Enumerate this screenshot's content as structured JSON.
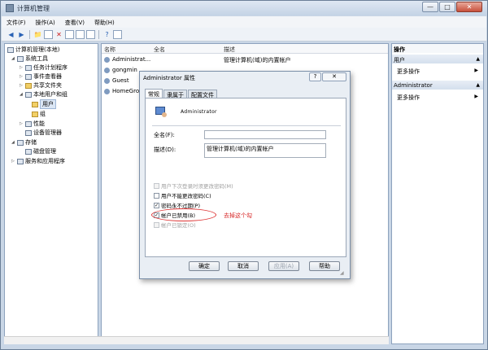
{
  "window": {
    "title": "计算机管理",
    "controls": {
      "minimize": "—",
      "maximize": "□",
      "close": "✕"
    }
  },
  "menu": [
    "文件(F)",
    "操作(A)",
    "查看(V)",
    "帮助(H)"
  ],
  "tree": {
    "root": "计算机管理(本地)",
    "system_tools": "系统工具",
    "task_scheduler": "任务计划程序",
    "event_viewer": "事件查看器",
    "shared_folders": "共享文件夹",
    "local_users_groups": "本地用户和组",
    "users": "用户",
    "groups": "组",
    "performance": "性能",
    "device_manager": "设备管理器",
    "storage": "存储",
    "disk_management": "磁盘管理",
    "services_apps": "服务和应用程序"
  },
  "list": {
    "columns": {
      "name": "名称",
      "fullname": "全名",
      "description": "描述"
    },
    "rows": [
      {
        "name": "Administrat...",
        "description": "管理计算机(域)的内置帐户"
      },
      {
        "name": "gongmin",
        "description": ""
      },
      {
        "name": "Guest",
        "description": ""
      },
      {
        "name": "HomeGrou...",
        "description": ""
      }
    ]
  },
  "actions": {
    "header": "操作",
    "section1": "用户",
    "more1": "更多操作",
    "section2": "Administrator",
    "more2": "更多操作"
  },
  "dialog": {
    "title": "Administrator 属性",
    "help": "?",
    "close": "✕",
    "tabs": [
      "常规",
      "隶属于",
      "配置文件"
    ],
    "username": "Administrator",
    "fullname_label": "全名(F):",
    "fullname_value": "",
    "desc_label": "描述(D):",
    "desc_value": "管理计算机(域)的内置帐户",
    "checkboxes": [
      {
        "label": "用户下次登录时须更改密码(M)",
        "checked": false,
        "disabled": true
      },
      {
        "label": "用户不能更改密码(C)",
        "checked": false,
        "disabled": false
      },
      {
        "label": "密码永不过期(P)",
        "checked": true,
        "disabled": false
      },
      {
        "label": "帐户已禁用(B)",
        "checked": true,
        "disabled": false
      },
      {
        "label": "帐户已锁定(O)",
        "checked": false,
        "disabled": true
      }
    ],
    "annotation": "去掉这个勾",
    "buttons": {
      "ok": "确定",
      "cancel": "取消",
      "apply": "应用(A)",
      "help": "帮助"
    }
  },
  "colors": {
    "annotation": "#d62020",
    "selection": "#dbe6f4",
    "titlebar": "#c4d3e5"
  }
}
